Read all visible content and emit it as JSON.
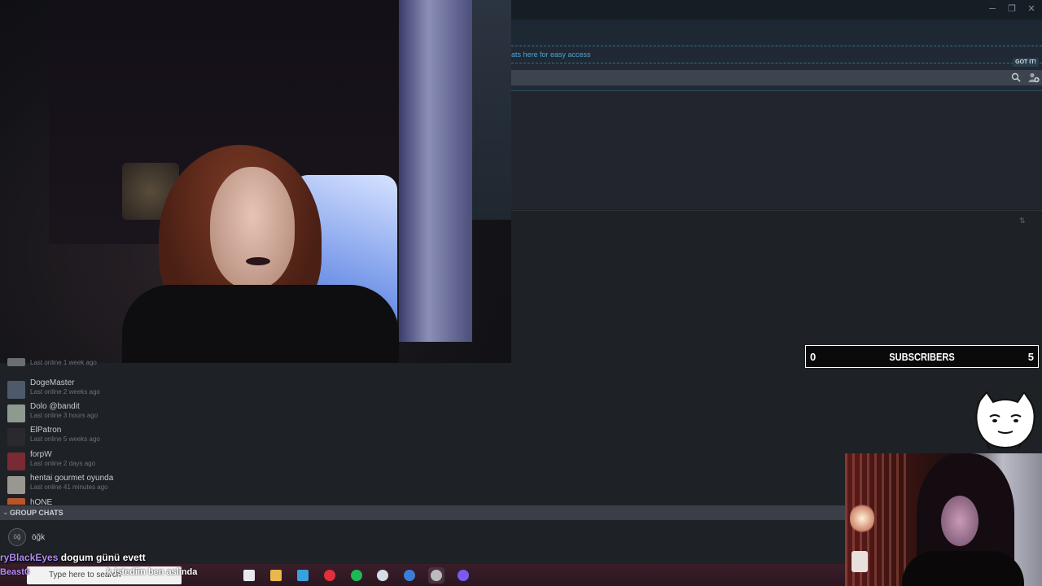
{
  "steam": {
    "tip_text": "ats here for easy access",
    "gotit_label": "GOT IT!",
    "window_controls": {
      "minimize": "─",
      "maximize": "❐",
      "close": "✕"
    },
    "icons": {
      "search": "search-icon",
      "add_friend": "add-friend-icon",
      "sort": "sort-icon"
    }
  },
  "friends": [
    {
      "name": "",
      "status": "Last online 1 week ago",
      "avatar_color": "#6a6e72"
    },
    {
      "name": "DogeMaster",
      "status": "Last online 2 weeks ago",
      "avatar_color": "#4e5a6a"
    },
    {
      "name": "Dolo @bandit",
      "status": "Last online 3 hours ago",
      "avatar_color": "#8e9990"
    },
    {
      "name": "ElPatron",
      "status": "Last online 5 weeks ago",
      "avatar_color": "#2a2a2e"
    },
    {
      "name": "forpW",
      "status": "Last online 2 days ago",
      "avatar_color": "#7a2a34"
    },
    {
      "name": "hentai gourmet oyunda",
      "status": "Last online 41 minutes ago",
      "avatar_color": "#9a9690"
    },
    {
      "name": "hONE",
      "status": "",
      "avatar_color": "#b8562a"
    }
  ],
  "group_chats": {
    "header": "GROUP CHATS",
    "items": [
      {
        "avatar_text": "öğ",
        "name": "öğk"
      }
    ]
  },
  "chat_overlay": {
    "line1_user": "ryBlackEyes",
    "line1_msg": "dogum günü evett",
    "line2_user": "Beast0",
    "line2_msg": "k istediin ben aslinda"
  },
  "taskbar": {
    "search_placeholder": "Type here to search",
    "apps": [
      {
        "name": "store",
        "color": "#e8e8ee"
      },
      {
        "name": "file-explorer",
        "color": "#e8b84a"
      },
      {
        "name": "edge",
        "color": "#3aa0e0"
      },
      {
        "name": "opera",
        "color": "#e0303a"
      },
      {
        "name": "spotify",
        "color": "#1db954"
      },
      {
        "name": "obs",
        "color": "#d8dce6"
      },
      {
        "name": "steam",
        "color": "#3b7ed8"
      },
      {
        "name": "obs-studio",
        "color": "#bcbcbc"
      },
      {
        "name": "discord",
        "color": "#7a5af0"
      }
    ]
  },
  "subscribers": {
    "left_count": "0",
    "title": "SUBSCRIBERS",
    "right_count": "5"
  }
}
